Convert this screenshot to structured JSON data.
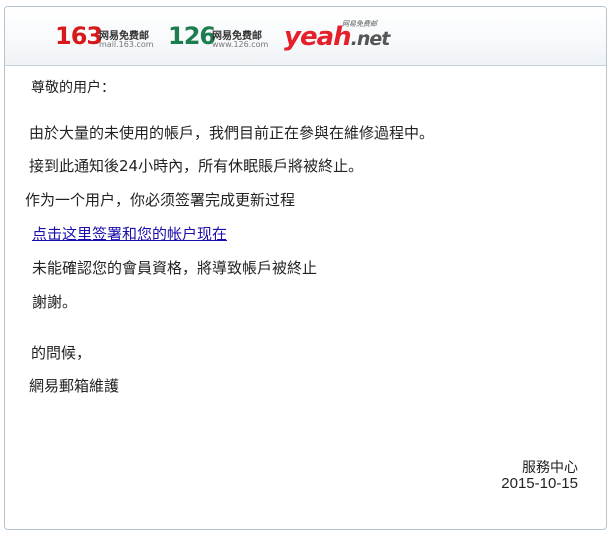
{
  "header": {
    "logo_163": {
      "number": "163",
      "name": "网易免费邮",
      "domain": "mail.163.com"
    },
    "logo_126": {
      "number": "126",
      "name": "网易免费邮",
      "domain": "www.126.com"
    },
    "logo_yeah": {
      "word": "yeah",
      "suffix": ".net",
      "tagline": "网易免费邮"
    },
    "colors": {
      "brand_163": "#d7191a",
      "brand_126": "#1c7d4e",
      "brand_yeah": "#e4212b"
    }
  },
  "message": {
    "greeting": "尊敬的用户：",
    "line1": "由於大量的未使用的帳戶，我們目前正在參與在維修過程中。",
    "line2": "接到此通知後24小時內，所有休眠賬戶將被終止。",
    "line3": "作为一个用户，你必须签署完成更新过程",
    "link_text": "点击这里签署和您的帐户现在",
    "line4": "未能確認您的會員資格，將導致帳戶被終止",
    "thanks": "謝謝。",
    "regards": "的問候，",
    "team": "網易郵箱維護",
    "department": "服務中心",
    "date": "2015-10-15",
    "link_color": "#1a0dab"
  }
}
